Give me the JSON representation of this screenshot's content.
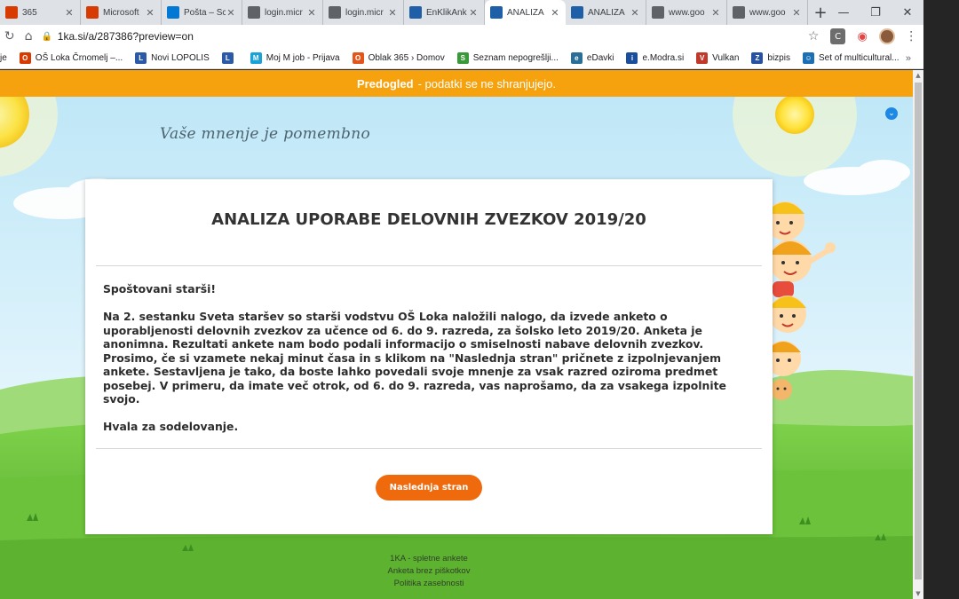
{
  "browser": {
    "tabs": [
      {
        "label": "365",
        "icon": "office-icon",
        "color": "#d83b01",
        "active": false
      },
      {
        "label": "Microsoft",
        "icon": "office-icon",
        "color": "#d83b01",
        "active": false
      },
      {
        "label": "Pošta – Sc",
        "icon": "outlook-icon",
        "color": "#0078d4",
        "active": false
      },
      {
        "label": "login.micr",
        "icon": "globe-icon",
        "color": "#5f6368",
        "active": false
      },
      {
        "label": "login.micr",
        "icon": "globe-icon",
        "color": "#5f6368",
        "active": false
      },
      {
        "label": "EnKlikAnk",
        "icon": "1ka-icon",
        "color": "#1e5fa8",
        "active": false
      },
      {
        "label": "ANALIZA",
        "icon": "1ka-icon",
        "color": "#1e5fa8",
        "active": true
      },
      {
        "label": "ANALIZA",
        "icon": "1ka-icon",
        "color": "#1e5fa8",
        "active": false
      },
      {
        "label": "www.goo",
        "icon": "globe-icon",
        "color": "#5f6368",
        "active": false
      },
      {
        "label": "www.goo",
        "icon": "globe-icon",
        "color": "#5f6368",
        "active": false
      }
    ],
    "url": "1ka.si/a/287386?preview=on",
    "bookmarks": [
      {
        "label": "je",
        "color": "#888888",
        "ic": ""
      },
      {
        "label": "OŠ Loka Črnomelj –...",
        "color": "#d83b01",
        "ic": "O"
      },
      {
        "label": "Novi LOPOLIS",
        "color": "#2b5aa6",
        "ic": "L"
      },
      {
        "label": "",
        "color": "#2b5aa6",
        "ic": "L"
      },
      {
        "label": "Moj M job - Prijava",
        "color": "#1aa3d9",
        "ic": "M"
      },
      {
        "label": "Oblak 365 › Domov",
        "color": "#e2561b",
        "ic": "O"
      },
      {
        "label": "Seznam nepogrešlji...",
        "color": "#3a9a3a",
        "ic": "S"
      },
      {
        "label": "eDavki",
        "color": "#2a6f97",
        "ic": "e"
      },
      {
        "label": "e.Modra.si",
        "color": "#1b4f9c",
        "ic": "i"
      },
      {
        "label": "Vulkan",
        "color": "#c0392b",
        "ic": "V"
      },
      {
        "label": "bizpis",
        "color": "#2552a3",
        "ic": "Z"
      },
      {
        "label": "Set of multicultural...",
        "color": "#1b6fb5",
        "ic": "☺"
      }
    ],
    "more_bookmarks": "»",
    "ext_c": "C"
  },
  "page": {
    "preview_strong": "Predogled",
    "preview_rest": "- podatki se ne shranjujejo.",
    "header_title": "Vaše mnenje je pomembno",
    "survey_title": "ANALIZA UPORABE DELOVNIH ZVEZKOV 2019/20",
    "intro": {
      "greeting": "Spoštovani starši!",
      "p1": "Na 2. sestanku Sveta staršev so starši  vodstvu OŠ Loka naložili nalogo, da izvede anketo o uporabljenosti delovnih zvezkov za učence od 6. do 9. razreda, za šolsko leto 2019/20. Anketa je anonimna.  Rezultati  ankete nam bodo podali informacijo  o smiselnosti nabave delovnih zvezkov.",
      "p2": "Prosimo, če si vzamete nekaj minut časa in s klikom na \"Naslednja stran\" pričnete z izpolnjevanjem ankete. Sestavljena je tako, da boste lahko povedali svoje mnenje za vsak razred oziroma predmet posebej. V primeru, da imate več otrok, od 6. do 9. razreda, vas naprošamo, da za vsakega izpolnite svojo.",
      "thanks": "Hvala za sodelovanje."
    },
    "next_button": "Naslednja stran",
    "footer": {
      "line1": "1KA - spletne ankete",
      "line2": "Anketa brez piškotkov",
      "line3": "Politika zasebnosti"
    }
  }
}
